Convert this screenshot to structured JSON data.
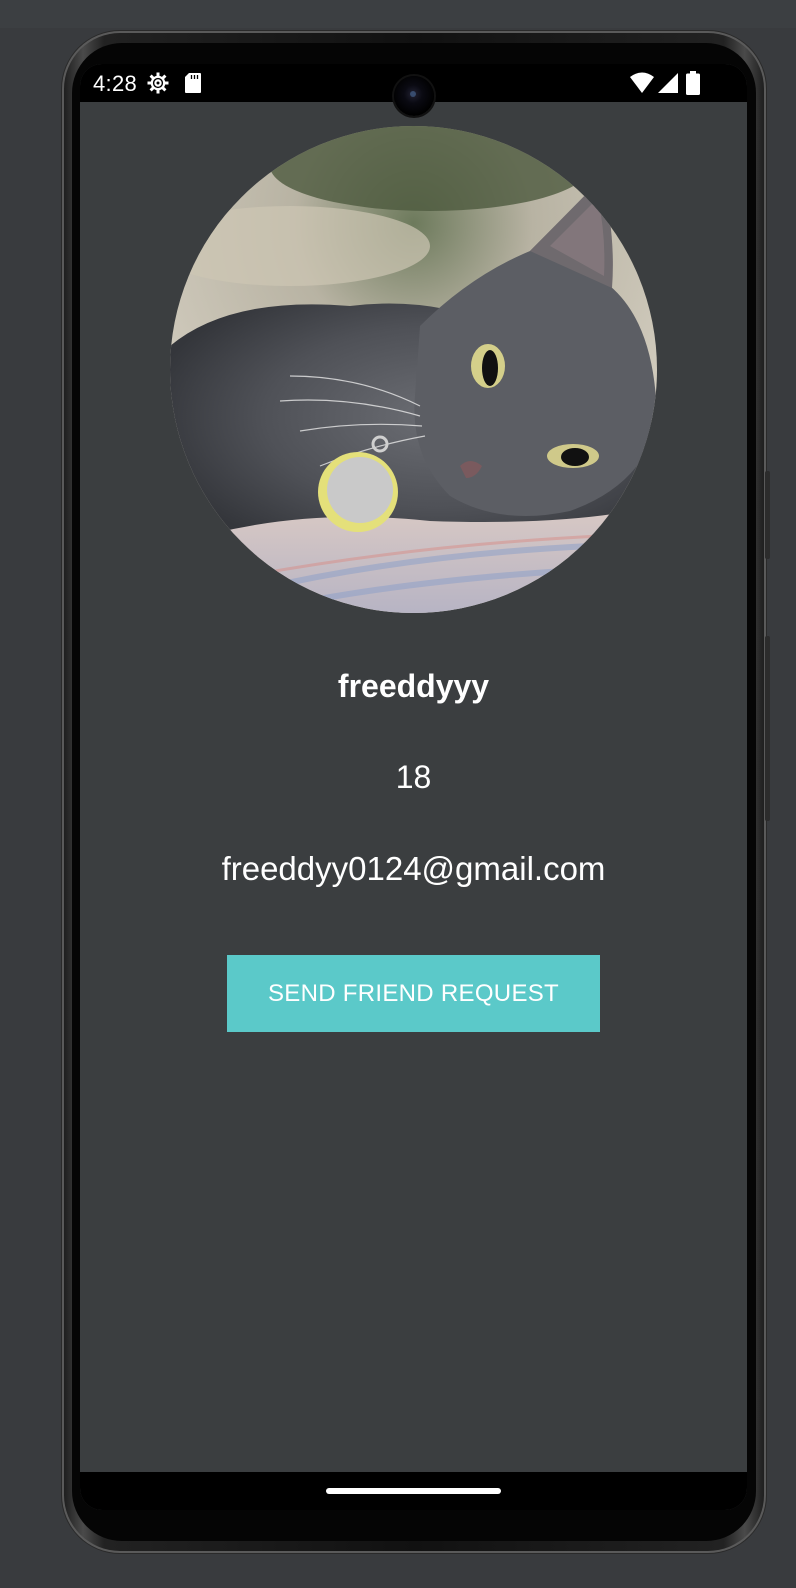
{
  "status_bar": {
    "time": "4:28",
    "left_icons": [
      "gear-icon",
      "sd-card-icon"
    ],
    "right_icons": [
      "wifi-icon",
      "cell-signal-icon",
      "battery-icon"
    ]
  },
  "profile": {
    "avatar": "cat-profile-photo",
    "username": "freeddyyy",
    "age": "18",
    "email": "freeddyy0124@gmail.com"
  },
  "actions": {
    "send_request_label": "SEND FRIEND REQUEST"
  },
  "colors": {
    "background": "#3b3e40",
    "button": "#5bc9c9",
    "text": "#ffffff",
    "bars": "#000000"
  }
}
